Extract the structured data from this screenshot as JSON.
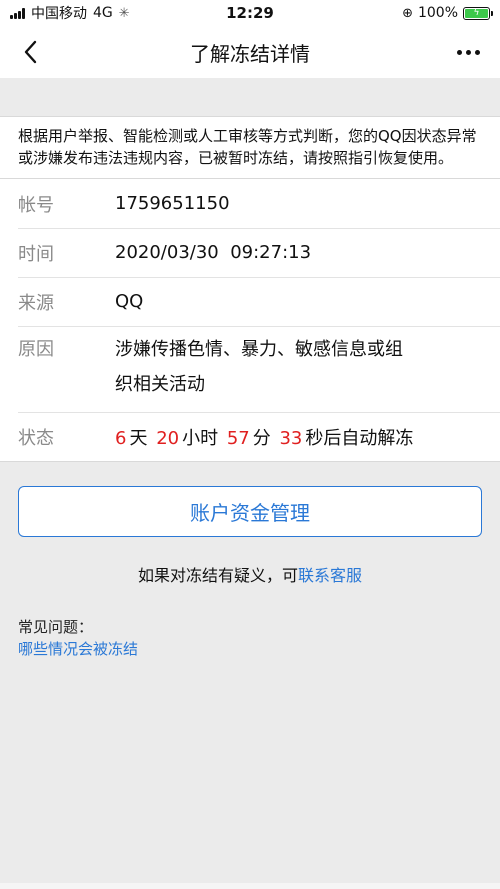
{
  "status_bar": {
    "carrier": "中国移动",
    "network": "4G",
    "time": "12:29",
    "battery_percent": "100%"
  },
  "nav": {
    "title": "了解冻结详情"
  },
  "notice": {
    "text": "根据用户举报、智能检测或人工审核等方式判断，您的QQ因状态异常或涉嫌发布违法违规内容，已被暂时冻结，请按照指引恢复使用。"
  },
  "info": {
    "account_label": "帐号",
    "account_value": "1759651150",
    "time_label": "时间",
    "time_value": "2020/03/30  09:27:13",
    "source_label": "来源",
    "source_value": "QQ",
    "reason_label": "原因",
    "reason_value_line1": "涉嫌传播色情、暴力、敏感信息或组",
    "reason_value_line2": "织相关活动",
    "status_label": "状态",
    "countdown": {
      "days": "6",
      "days_unit": "天",
      "hours": "20",
      "hours_unit": "小时",
      "minutes": "57",
      "minutes_unit": "分",
      "seconds": "33",
      "suffix": "秒后自动解冻"
    }
  },
  "actions": {
    "fund_management_label": "账户资金管理"
  },
  "question": {
    "prefix": "如果对冻结有疑义，可",
    "link": "联系客服"
  },
  "faq": {
    "title": "常见问题：",
    "link": "哪些情况会被冻结"
  },
  "colors": {
    "accent": "#2a78d6",
    "countdown": "#e02020",
    "background": "#ebebeb"
  }
}
